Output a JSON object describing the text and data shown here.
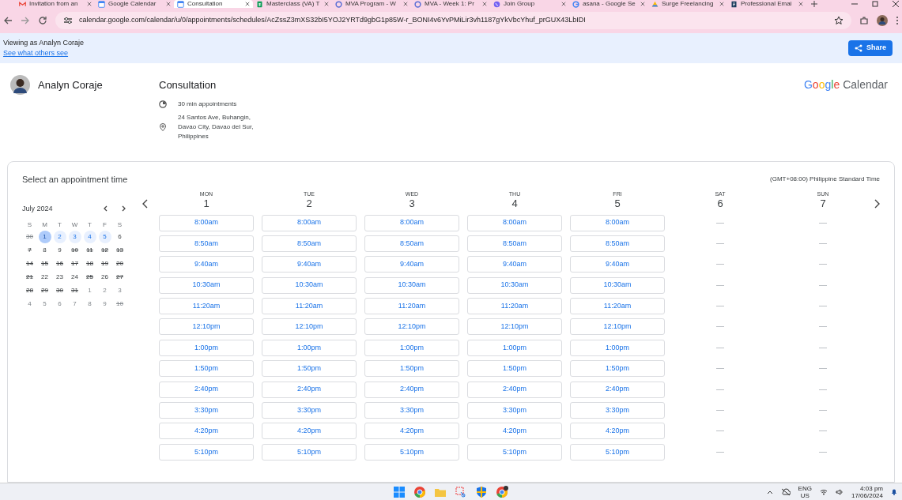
{
  "browser": {
    "tabs": [
      {
        "title": "Invitation from an",
        "kind": "mail",
        "selected": false
      },
      {
        "title": "Google Calendar",
        "kind": "calendar",
        "selected": false
      },
      {
        "title": "Consultation",
        "kind": "calendar",
        "selected": true
      },
      {
        "title": "Masterclass (VA) T",
        "kind": "sheet",
        "selected": false
      },
      {
        "title": "MVA Program - W",
        "kind": "circle",
        "selected": false
      },
      {
        "title": "MVA - Week 1: Pr",
        "kind": "circle",
        "selected": false
      },
      {
        "title": "Join Group",
        "kind": "phone",
        "selected": false
      },
      {
        "title": "asana - Google Se",
        "kind": "google",
        "selected": false
      },
      {
        "title": "Surge Freelancing",
        "kind": "drive",
        "selected": false
      },
      {
        "title": "Professional Emai",
        "kind": "doc",
        "selected": false
      }
    ],
    "url": "calendar.google.com/calendar/u/0/appointments/schedules/AcZssZ3mXS32bI5YOJ2YRTd9gbG1p85W-r_BONI4v6YvPMiLir3vh1187gYkVbcYhuf_prGUX43LbIDI"
  },
  "banner": {
    "text": "Viewing as Analyn Coraje",
    "link": "See what others see",
    "button": "Share"
  },
  "host": {
    "name": "Analyn Coraje"
  },
  "event": {
    "title": "Consultation",
    "duration": "30 min appointments",
    "address": [
      "24 Santos Ave, Buhangin,",
      "Davao City, Davao del Sur,",
      "Philippines"
    ]
  },
  "brand": {
    "google": "Google",
    "product": "Calendar"
  },
  "booking": {
    "heading": "Select an appointment time",
    "timezone": "(GMT+08:00) Philippine Standard Time",
    "mini_calendar": {
      "month": "July 2024",
      "weekdays": [
        "S",
        "M",
        "T",
        "W",
        "T",
        "F",
        "S"
      ],
      "weeks": [
        [
          {
            "d": "30",
            "struck": true,
            "outside": true,
            "selected": false,
            "available": false
          },
          {
            "d": "1",
            "struck": false,
            "outside": false,
            "selected": true,
            "available": true
          },
          {
            "d": "2",
            "struck": false,
            "outside": false,
            "selected": false,
            "available": true
          },
          {
            "d": "3",
            "struck": false,
            "outside": false,
            "selected": false,
            "available": true
          },
          {
            "d": "4",
            "struck": false,
            "outside": false,
            "selected": false,
            "available": true
          },
          {
            "d": "5",
            "struck": false,
            "outside": false,
            "selected": false,
            "available": true
          },
          {
            "d": "6",
            "struck": false,
            "outside": false,
            "selected": false,
            "available": false
          }
        ],
        [
          {
            "d": "7",
            "struck": true,
            "outside": false,
            "selected": false,
            "available": false
          },
          {
            "d": "8",
            "struck": false,
            "outside": false,
            "selected": false,
            "available": false
          },
          {
            "d": "9",
            "struck": false,
            "outside": false,
            "selected": false,
            "available": false
          },
          {
            "d": "10",
            "struck": true,
            "outside": false,
            "selected": false,
            "available": false
          },
          {
            "d": "11",
            "struck": true,
            "outside": false,
            "selected": false,
            "available": false
          },
          {
            "d": "12",
            "struck": true,
            "outside": false,
            "selected": false,
            "available": false
          },
          {
            "d": "13",
            "struck": true,
            "outside": false,
            "selected": false,
            "available": false
          }
        ],
        [
          {
            "d": "14",
            "struck": true,
            "outside": false,
            "selected": false,
            "available": false
          },
          {
            "d": "15",
            "struck": true,
            "outside": false,
            "selected": false,
            "available": false
          },
          {
            "d": "16",
            "struck": true,
            "outside": false,
            "selected": false,
            "available": false
          },
          {
            "d": "17",
            "struck": true,
            "outside": false,
            "selected": false,
            "available": false
          },
          {
            "d": "18",
            "struck": true,
            "outside": false,
            "selected": false,
            "available": false
          },
          {
            "d": "19",
            "struck": true,
            "outside": false,
            "selected": false,
            "available": false
          },
          {
            "d": "20",
            "struck": true,
            "outside": false,
            "selected": false,
            "available": false
          }
        ],
        [
          {
            "d": "21",
            "struck": true,
            "outside": false,
            "selected": false,
            "available": false
          },
          {
            "d": "22",
            "struck": false,
            "outside": false,
            "selected": false,
            "available": false
          },
          {
            "d": "23",
            "struck": false,
            "outside": false,
            "selected": false,
            "available": false
          },
          {
            "d": "24",
            "struck": false,
            "outside": false,
            "selected": false,
            "available": false
          },
          {
            "d": "25",
            "struck": true,
            "outside": false,
            "selected": false,
            "available": false
          },
          {
            "d": "26",
            "struck": false,
            "outside": false,
            "selected": false,
            "available": false
          },
          {
            "d": "27",
            "struck": true,
            "outside": false,
            "selected": false,
            "available": false
          }
        ],
        [
          {
            "d": "28",
            "struck": true,
            "outside": false,
            "selected": false,
            "available": false
          },
          {
            "d": "29",
            "struck": true,
            "outside": false,
            "selected": false,
            "available": false
          },
          {
            "d": "30",
            "struck": true,
            "outside": false,
            "selected": false,
            "available": false
          },
          {
            "d": "31",
            "struck": true,
            "outside": false,
            "selected": false,
            "available": false
          },
          {
            "d": "1",
            "struck": false,
            "outside": true,
            "selected": false,
            "available": false
          },
          {
            "d": "2",
            "struck": false,
            "outside": true,
            "selected": false,
            "available": false
          },
          {
            "d": "3",
            "struck": false,
            "outside": true,
            "selected": false,
            "available": false
          }
        ],
        [
          {
            "d": "4",
            "struck": false,
            "outside": true,
            "selected": false,
            "available": false
          },
          {
            "d": "5",
            "struck": false,
            "outside": true,
            "selected": false,
            "available": false
          },
          {
            "d": "6",
            "struck": false,
            "outside": true,
            "selected": false,
            "available": false
          },
          {
            "d": "7",
            "struck": false,
            "outside": true,
            "selected": false,
            "available": false
          },
          {
            "d": "8",
            "struck": false,
            "outside": true,
            "selected": false,
            "available": false
          },
          {
            "d": "9",
            "struck": false,
            "outside": true,
            "selected": false,
            "available": false
          },
          {
            "d": "10",
            "struck": true,
            "outside": true,
            "selected": false,
            "available": false
          }
        ]
      ]
    },
    "days": [
      {
        "weekday": "MON",
        "date": "1",
        "available": true,
        "slots": [
          "8:00am",
          "8:50am",
          "9:40am",
          "10:30am",
          "11:20am",
          "12:10pm",
          "1:00pm",
          "1:50pm",
          "2:40pm",
          "3:30pm",
          "4:20pm",
          "5:10pm"
        ]
      },
      {
        "weekday": "TUE",
        "date": "2",
        "available": true,
        "slots": [
          "8:00am",
          "8:50am",
          "9:40am",
          "10:30am",
          "11:20am",
          "12:10pm",
          "1:00pm",
          "1:50pm",
          "2:40pm",
          "3:30pm",
          "4:20pm",
          "5:10pm"
        ]
      },
      {
        "weekday": "WED",
        "date": "3",
        "available": true,
        "slots": [
          "8:00am",
          "8:50am",
          "9:40am",
          "10:30am",
          "11:20am",
          "12:10pm",
          "1:00pm",
          "1:50pm",
          "2:40pm",
          "3:30pm",
          "4:20pm",
          "5:10pm"
        ]
      },
      {
        "weekday": "THU",
        "date": "4",
        "available": true,
        "slots": [
          "8:00am",
          "8:50am",
          "9:40am",
          "10:30am",
          "11:20am",
          "12:10pm",
          "1:00pm",
          "1:50pm",
          "2:40pm",
          "3:30pm",
          "4:20pm",
          "5:10pm"
        ]
      },
      {
        "weekday": "FRI",
        "date": "5",
        "available": true,
        "slots": [
          "8:00am",
          "8:50am",
          "9:40am",
          "10:30am",
          "11:20am",
          "12:10pm",
          "1:00pm",
          "1:50pm",
          "2:40pm",
          "3:30pm",
          "4:20pm",
          "5:10pm"
        ]
      },
      {
        "weekday": "SAT",
        "date": "6",
        "available": false
      },
      {
        "weekday": "SUN",
        "date": "7",
        "available": false
      }
    ]
  },
  "taskbar": {
    "language": [
      "ENG",
      "US"
    ],
    "time": "4:03 pm",
    "date": "17/06/2024"
  }
}
